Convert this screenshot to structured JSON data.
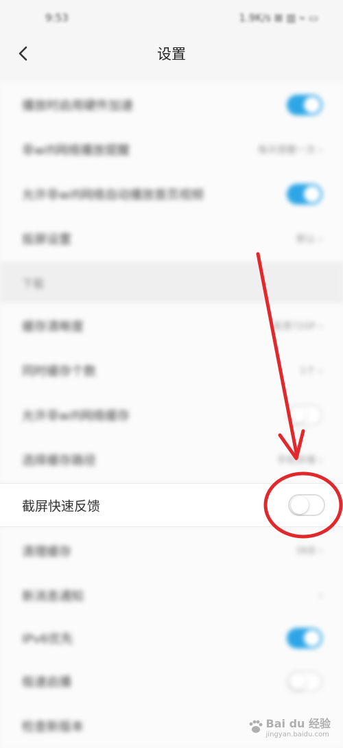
{
  "status_bar": {
    "time": "9:53",
    "indicators": "1.9K/s ⊠ ▥ ⌁ ▭"
  },
  "header": {
    "title": "设置",
    "back_icon": "chevron-left-icon"
  },
  "rows": [
    {
      "label": "播放时启用硬件加速",
      "value": "",
      "control": "toggle",
      "on": true
    },
    {
      "label": "非wifi网络播放提醒",
      "value": "每天提醒一次",
      "control": "chevron"
    },
    {
      "label": "允许非wifi网络自动播放首页视频",
      "value": "",
      "control": "toggle",
      "on": true
    },
    {
      "label": "投屏设置",
      "value": "默认",
      "control": "chevron"
    },
    {
      "label": "缓存清晰度",
      "value": "高清720P",
      "control": "chevron"
    },
    {
      "label": "同时缓存个数",
      "value": "1个",
      "control": "chevron"
    },
    {
      "label": "允许非wifi网络缓存",
      "value": "",
      "control": "toggle",
      "on": false
    },
    {
      "label": "选择缓存路径",
      "value": "手机存储",
      "control": "chevron"
    },
    {
      "label": "清理缓存",
      "value": "0KB",
      "control": "chevron"
    },
    {
      "label": "新消息通知",
      "value": "",
      "control": "chevron"
    },
    {
      "label": "IPv6优先",
      "value": "",
      "control": "toggle",
      "on": true
    },
    {
      "label": "极速启播",
      "value": "",
      "control": "toggle",
      "on": false
    },
    {
      "label": "检查新版本",
      "value": "",
      "control": "chevron"
    }
  ],
  "section": {
    "label": "下载"
  },
  "highlight": {
    "label": "截屏快速反馈",
    "on": false
  },
  "annotation": {
    "color": "#e0282d"
  },
  "watermark": {
    "text": "Bai du 经验",
    "subtext": "jingyan.baidu.com"
  },
  "colors": {
    "toggle_on": "#2ea6e6",
    "background": "#f6f6f6"
  }
}
